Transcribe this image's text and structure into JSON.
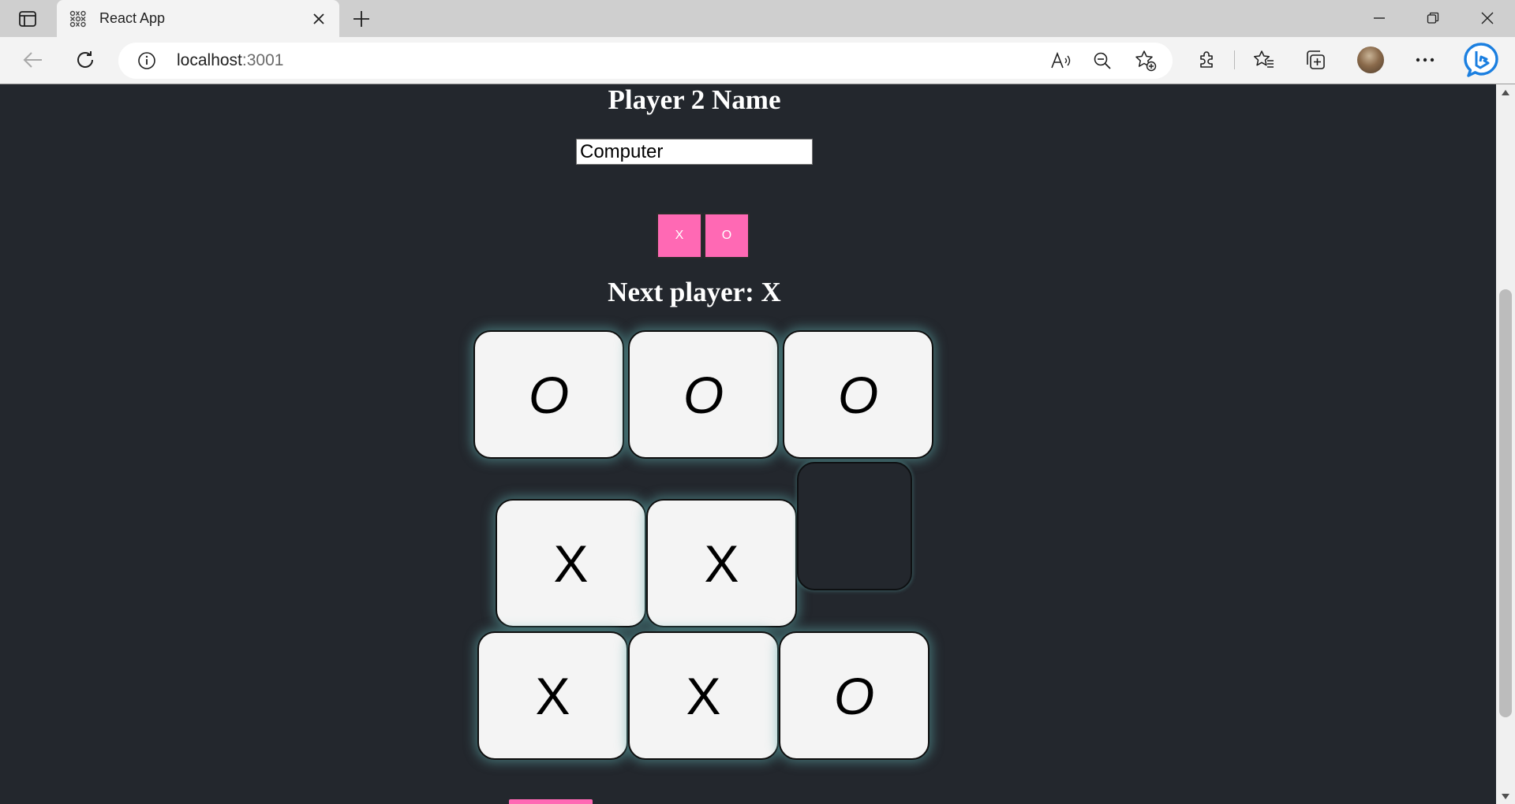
{
  "browser": {
    "tab_title": "React App",
    "address_host": "localhost",
    "address_port": ":3001"
  },
  "page": {
    "player2_heading": "Player 2 Name",
    "player2_name_value": "Computer",
    "symbol_buttons": [
      {
        "label": "X"
      },
      {
        "label": "O"
      }
    ],
    "status": "Next player: X",
    "board": [
      [
        "O",
        "O",
        "O"
      ],
      [
        "X",
        "X",
        ""
      ],
      [
        "X",
        "X",
        "O"
      ]
    ]
  },
  "colors": {
    "background": "#23272d",
    "accent_pink": "#ff69b4",
    "square_fill": "#f4f4f4",
    "square_glow": "#5facac",
    "bing_blue": "#1b7fe0"
  },
  "icons": {
    "browser": [
      "sidebar-toggle-icon",
      "tab-favicon-icon",
      "close-icon",
      "plus-icon",
      "minimize-icon",
      "restore-icon",
      "back-arrow-icon",
      "refresh-icon",
      "info-icon",
      "read-aloud-icon",
      "zoom-out-icon",
      "add-favorite-icon",
      "extensions-icon",
      "favorites-icon",
      "collections-icon",
      "more-icon",
      "bing-icon"
    ]
  }
}
